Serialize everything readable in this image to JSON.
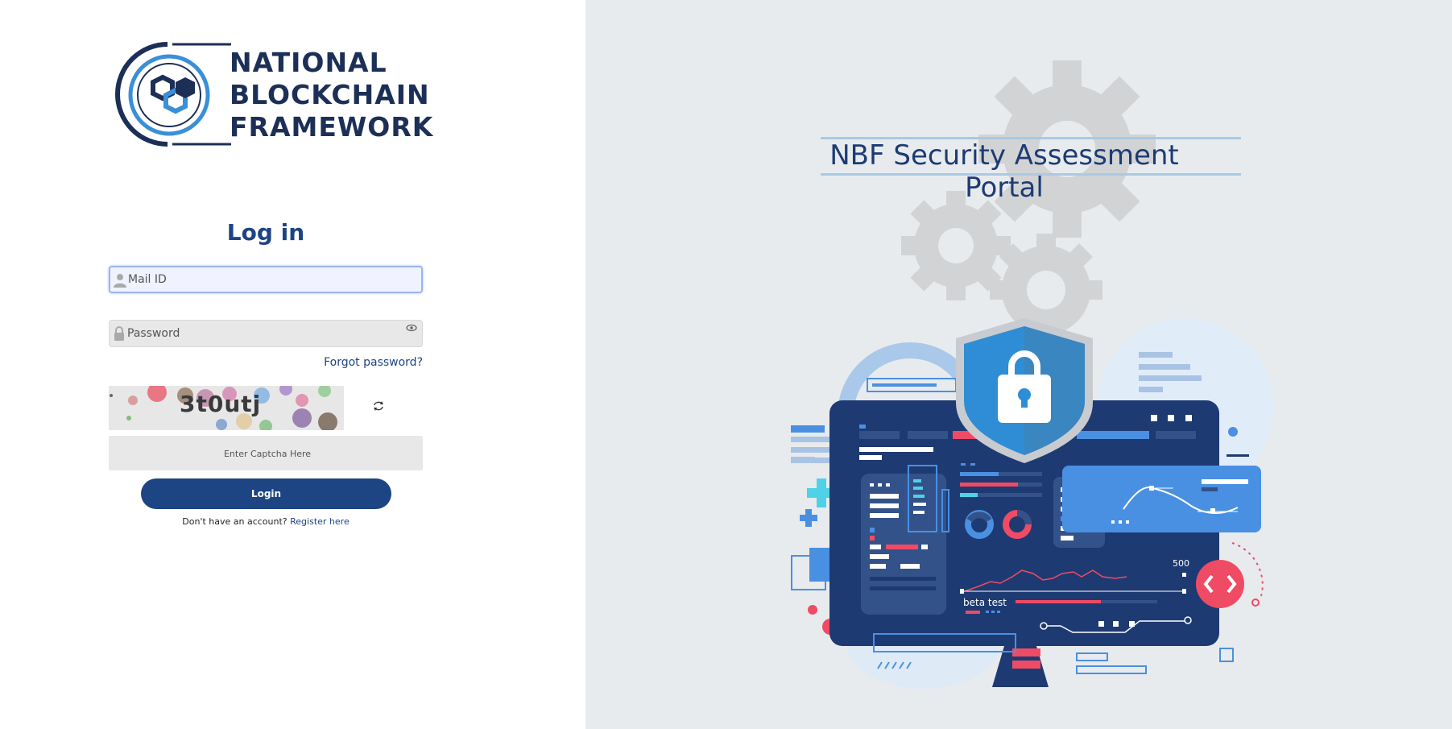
{
  "logo": {
    "lines": [
      "NATIONAL",
      "BLOCKCHAIN",
      "FRAMEWORK"
    ]
  },
  "login": {
    "title": "Log in",
    "mail_placeholder": "Mail ID",
    "password_placeholder": "Password",
    "forgot_label": "Forgot password?",
    "captcha_text": "3t0utj",
    "captcha_placeholder": "Enter Captcha Here",
    "login_label": "Login",
    "no_account_text": "Don't have an account?",
    "register_label": "Register here"
  },
  "portal": {
    "title": "NBF Security Assessment Portal",
    "chart_label_500": "500",
    "beta_label": "beta test"
  },
  "colors": {
    "brand": "#1d4483",
    "accent_blue": "#4a90e2",
    "accent_red": "#f04b64"
  }
}
